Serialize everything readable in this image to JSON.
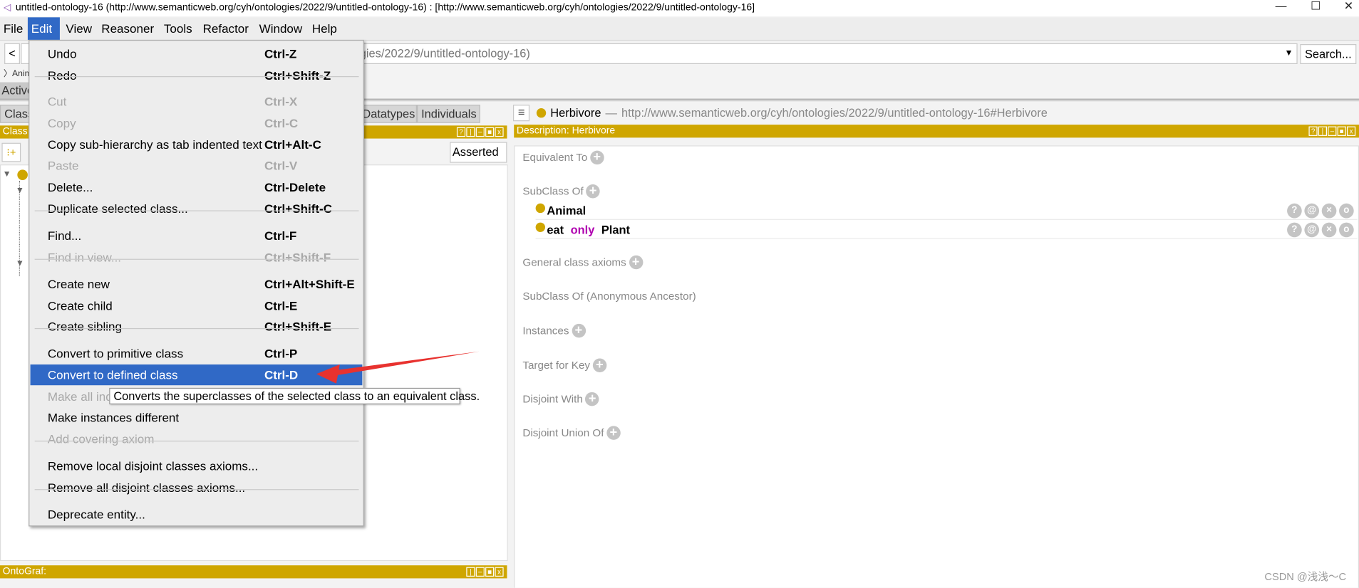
{
  "window": {
    "title": "untitled-ontology-16 (http://www.semanticweb.org/cyh/ontologies/2022/9/untitled-ontology-16)  : [http://www.semanticweb.org/cyh/ontologies/2022/9/untitled-ontology-16]",
    "minimize": "—",
    "maximize": "☐",
    "close": "✕"
  },
  "menubar": [
    "File",
    "Edit",
    "View",
    "Reasoner",
    "Tools",
    "Refactor",
    "Window",
    "Help"
  ],
  "nav": {
    "back": "<",
    "address": "gies/2022/9/untitled-ontology-16)",
    "search": "Search...",
    "breadcrumb": "Anim",
    "active_tab": "Active"
  },
  "left": {
    "tabs": [
      "Class",
      "Datatypes",
      "Individuals"
    ],
    "class_header": "Class",
    "asserted": "Asserted",
    "ontograf": "OntoGraf:"
  },
  "right": {
    "entity": "Herbivore",
    "iri": "http://www.semanticweb.org/cyh/ontologies/2022/9/untitled-ontology-16#Herbivore",
    "desc_header": "Description: Herbivore",
    "sections": {
      "equivalent": "Equivalent To",
      "subclass": "SubClass Of",
      "general": "General class axioms",
      "anon": "SubClass Of (Anonymous Ancestor)",
      "instances": "Instances",
      "target": "Target for Key",
      "disjoint": "Disjoint With",
      "union": "Disjoint Union Of"
    },
    "superclasses": [
      {
        "text": "Animal"
      },
      {
        "prop": "eat",
        "kw": "only",
        "filler": "Plant"
      }
    ],
    "kw_color": "#b000b0"
  },
  "edit_menu": [
    {
      "label": "Undo",
      "shortcut": "Ctrl-Z"
    },
    {
      "label": "Redo",
      "shortcut": "Ctrl+Shift-Z"
    },
    {
      "label": "Cut",
      "shortcut": "Ctrl-X",
      "disabled": true,
      "sep": true
    },
    {
      "label": "Copy",
      "shortcut": "Ctrl-C",
      "disabled": true
    },
    {
      "label": "Copy sub-hierarchy as tab indented text",
      "shortcut": "Ctrl+Alt-C"
    },
    {
      "label": "Paste",
      "shortcut": "Ctrl-V",
      "disabled": true
    },
    {
      "label": "Delete...",
      "shortcut": "Ctrl-Delete"
    },
    {
      "label": "Duplicate selected class...",
      "shortcut": "Ctrl+Shift-C"
    },
    {
      "label": "Find...",
      "shortcut": "Ctrl-F",
      "sep": true
    },
    {
      "label": "Find in view...",
      "shortcut": "Ctrl+Shift-F",
      "disabled": true
    },
    {
      "label": "Create new",
      "shortcut": "Ctrl+Alt+Shift-E",
      "sep": true
    },
    {
      "label": "Create child",
      "shortcut": "Ctrl-E"
    },
    {
      "label": "Create sibling",
      "shortcut": "Ctrl+Shift-E"
    },
    {
      "label": "Convert to primitive class",
      "shortcut": "Ctrl-P",
      "sep": true
    },
    {
      "label": "Convert to defined class",
      "shortcut": "Ctrl-D",
      "highlighted": true
    },
    {
      "label": "Make all ind",
      "shortcut": "",
      "disabled": true
    },
    {
      "label": "Make instances different",
      "shortcut": ""
    },
    {
      "label": "Add covering axiom",
      "shortcut": "",
      "disabled": true
    },
    {
      "label": "Remove local disjoint classes axioms...",
      "shortcut": "",
      "sep": true
    },
    {
      "label": "Remove all disjoint classes axioms...",
      "shortcut": ""
    },
    {
      "label": "Deprecate entity...",
      "shortcut": "",
      "sep": true
    }
  ],
  "tooltip": "Converts the superclasses of the selected class to an equivalent class.",
  "watermark": "CSDN @浅浅～C",
  "colors": {
    "accent": "#cfa600",
    "selection": "#3069c6",
    "arrow": "#e8322f"
  }
}
